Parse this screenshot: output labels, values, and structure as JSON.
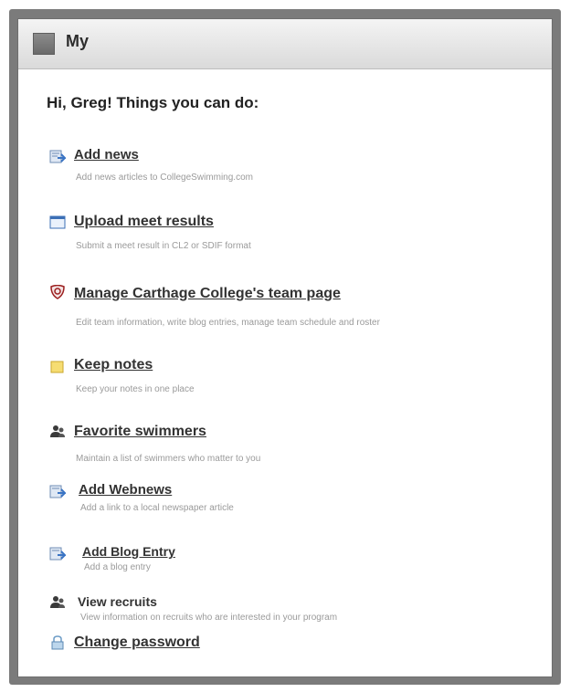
{
  "panel": {
    "title": "My",
    "greeting": "Hi, Greg! Things you can do:"
  },
  "actions": [
    {
      "label": "Add news",
      "description": "Add news articles to CollegeSwimming.com",
      "icon": "add-news-icon"
    },
    {
      "label": "Upload meet results",
      "description": "Submit a meet result in CL2 or SDIF format",
      "icon": "calendar-window-icon"
    },
    {
      "label": "Manage Carthage College's team page",
      "description": "Edit team information, write blog entries, manage team schedule and roster",
      "icon": "team-shield-icon"
    },
    {
      "label": "Keep notes",
      "description": "Keep your notes in one place",
      "icon": "notes-icon"
    },
    {
      "label": "Favorite swimmers",
      "description": "Maintain a list of swimmers who matter to you",
      "icon": "users-icon"
    },
    {
      "label": "Add Webnews",
      "description": "Add a link to a local newspaper article",
      "icon": "add-webnews-icon"
    },
    {
      "label": "Add Blog Entry",
      "description": "Add a blog entry",
      "icon": "add-blog-icon"
    },
    {
      "label": "View recruits",
      "description": "View information on recruits who are interested in your program",
      "icon": "recruits-icon"
    },
    {
      "label": "Change password",
      "description": "",
      "icon": "lock-icon"
    }
  ]
}
